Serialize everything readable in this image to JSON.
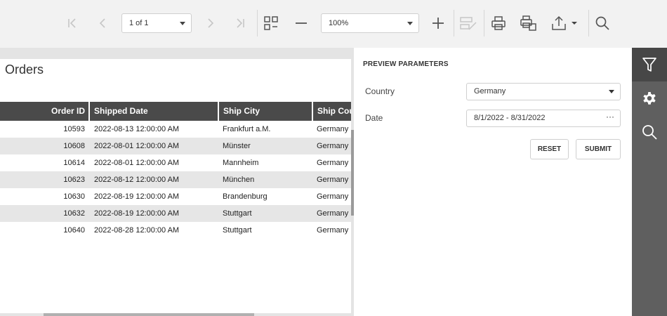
{
  "toolbar": {
    "page_selector": "1 of 1",
    "zoom_selector": "100%",
    "buttons": [
      {
        "name": "first-page",
        "icon": "first-page-icon",
        "enabled": false
      },
      {
        "name": "prev-page",
        "icon": "chevron-left-icon",
        "enabled": false
      },
      {
        "name": "next-page",
        "icon": "chevron-right-icon",
        "enabled": false
      },
      {
        "name": "last-page",
        "icon": "last-page-icon",
        "enabled": false
      },
      {
        "name": "multipage",
        "icon": "multipage-icon",
        "enabled": true
      },
      {
        "name": "zoom-out",
        "icon": "minus-icon",
        "enabled": true
      },
      {
        "name": "zoom-in",
        "icon": "plus-icon",
        "enabled": true
      },
      {
        "name": "editing-fields",
        "icon": "edit-fields-icon",
        "enabled": false
      },
      {
        "name": "print",
        "icon": "printer-icon",
        "enabled": true
      },
      {
        "name": "print-page",
        "icon": "print-page-icon",
        "enabled": true
      },
      {
        "name": "export",
        "icon": "export-icon",
        "enabled": true
      },
      {
        "name": "search",
        "icon": "search-icon",
        "enabled": true
      }
    ]
  },
  "report": {
    "title": "Orders",
    "columns": [
      "Order ID",
      "Shipped Date",
      "Ship City",
      "Ship Cou"
    ],
    "rows": [
      [
        "10593",
        "2022-08-13 12:00:00 AM",
        "Frankfurt a.M.",
        "Germany"
      ],
      [
        "10608",
        "2022-08-01 12:00:00 AM",
        "Münster",
        "Germany"
      ],
      [
        "10614",
        "2022-08-01 12:00:00 AM",
        "Mannheim",
        "Germany"
      ],
      [
        "10623",
        "2022-08-12 12:00:00 AM",
        "München",
        "Germany"
      ],
      [
        "10630",
        "2022-08-19 12:00:00 AM",
        "Brandenburg",
        "Germany"
      ],
      [
        "10632",
        "2022-08-19 12:00:00 AM",
        "Stuttgart",
        "Germany"
      ],
      [
        "10640",
        "2022-08-28 12:00:00 AM",
        "Stuttgart",
        "Germany"
      ]
    ]
  },
  "panel": {
    "title": "PREVIEW PARAMETERS",
    "params": [
      {
        "label": "Country",
        "value": "Germany",
        "type": "select"
      },
      {
        "label": "Date",
        "value": "8/1/2022 - 8/31/2022",
        "type": "range",
        "ellipsis": "···"
      }
    ],
    "reset_label": "RESET",
    "submit_label": "SUBMIT"
  },
  "tabs": [
    {
      "icon": "filter-icon",
      "active": true
    },
    {
      "icon": "gear-icon",
      "active": false
    },
    {
      "icon": "search-icon",
      "active": false
    }
  ],
  "colors": {
    "toolbar_bg": "#f2f2f2",
    "table_header_bg": "#4a4a4a",
    "tabstrip_bg": "#5f5f5f",
    "tab_active_bg": "#474747"
  }
}
